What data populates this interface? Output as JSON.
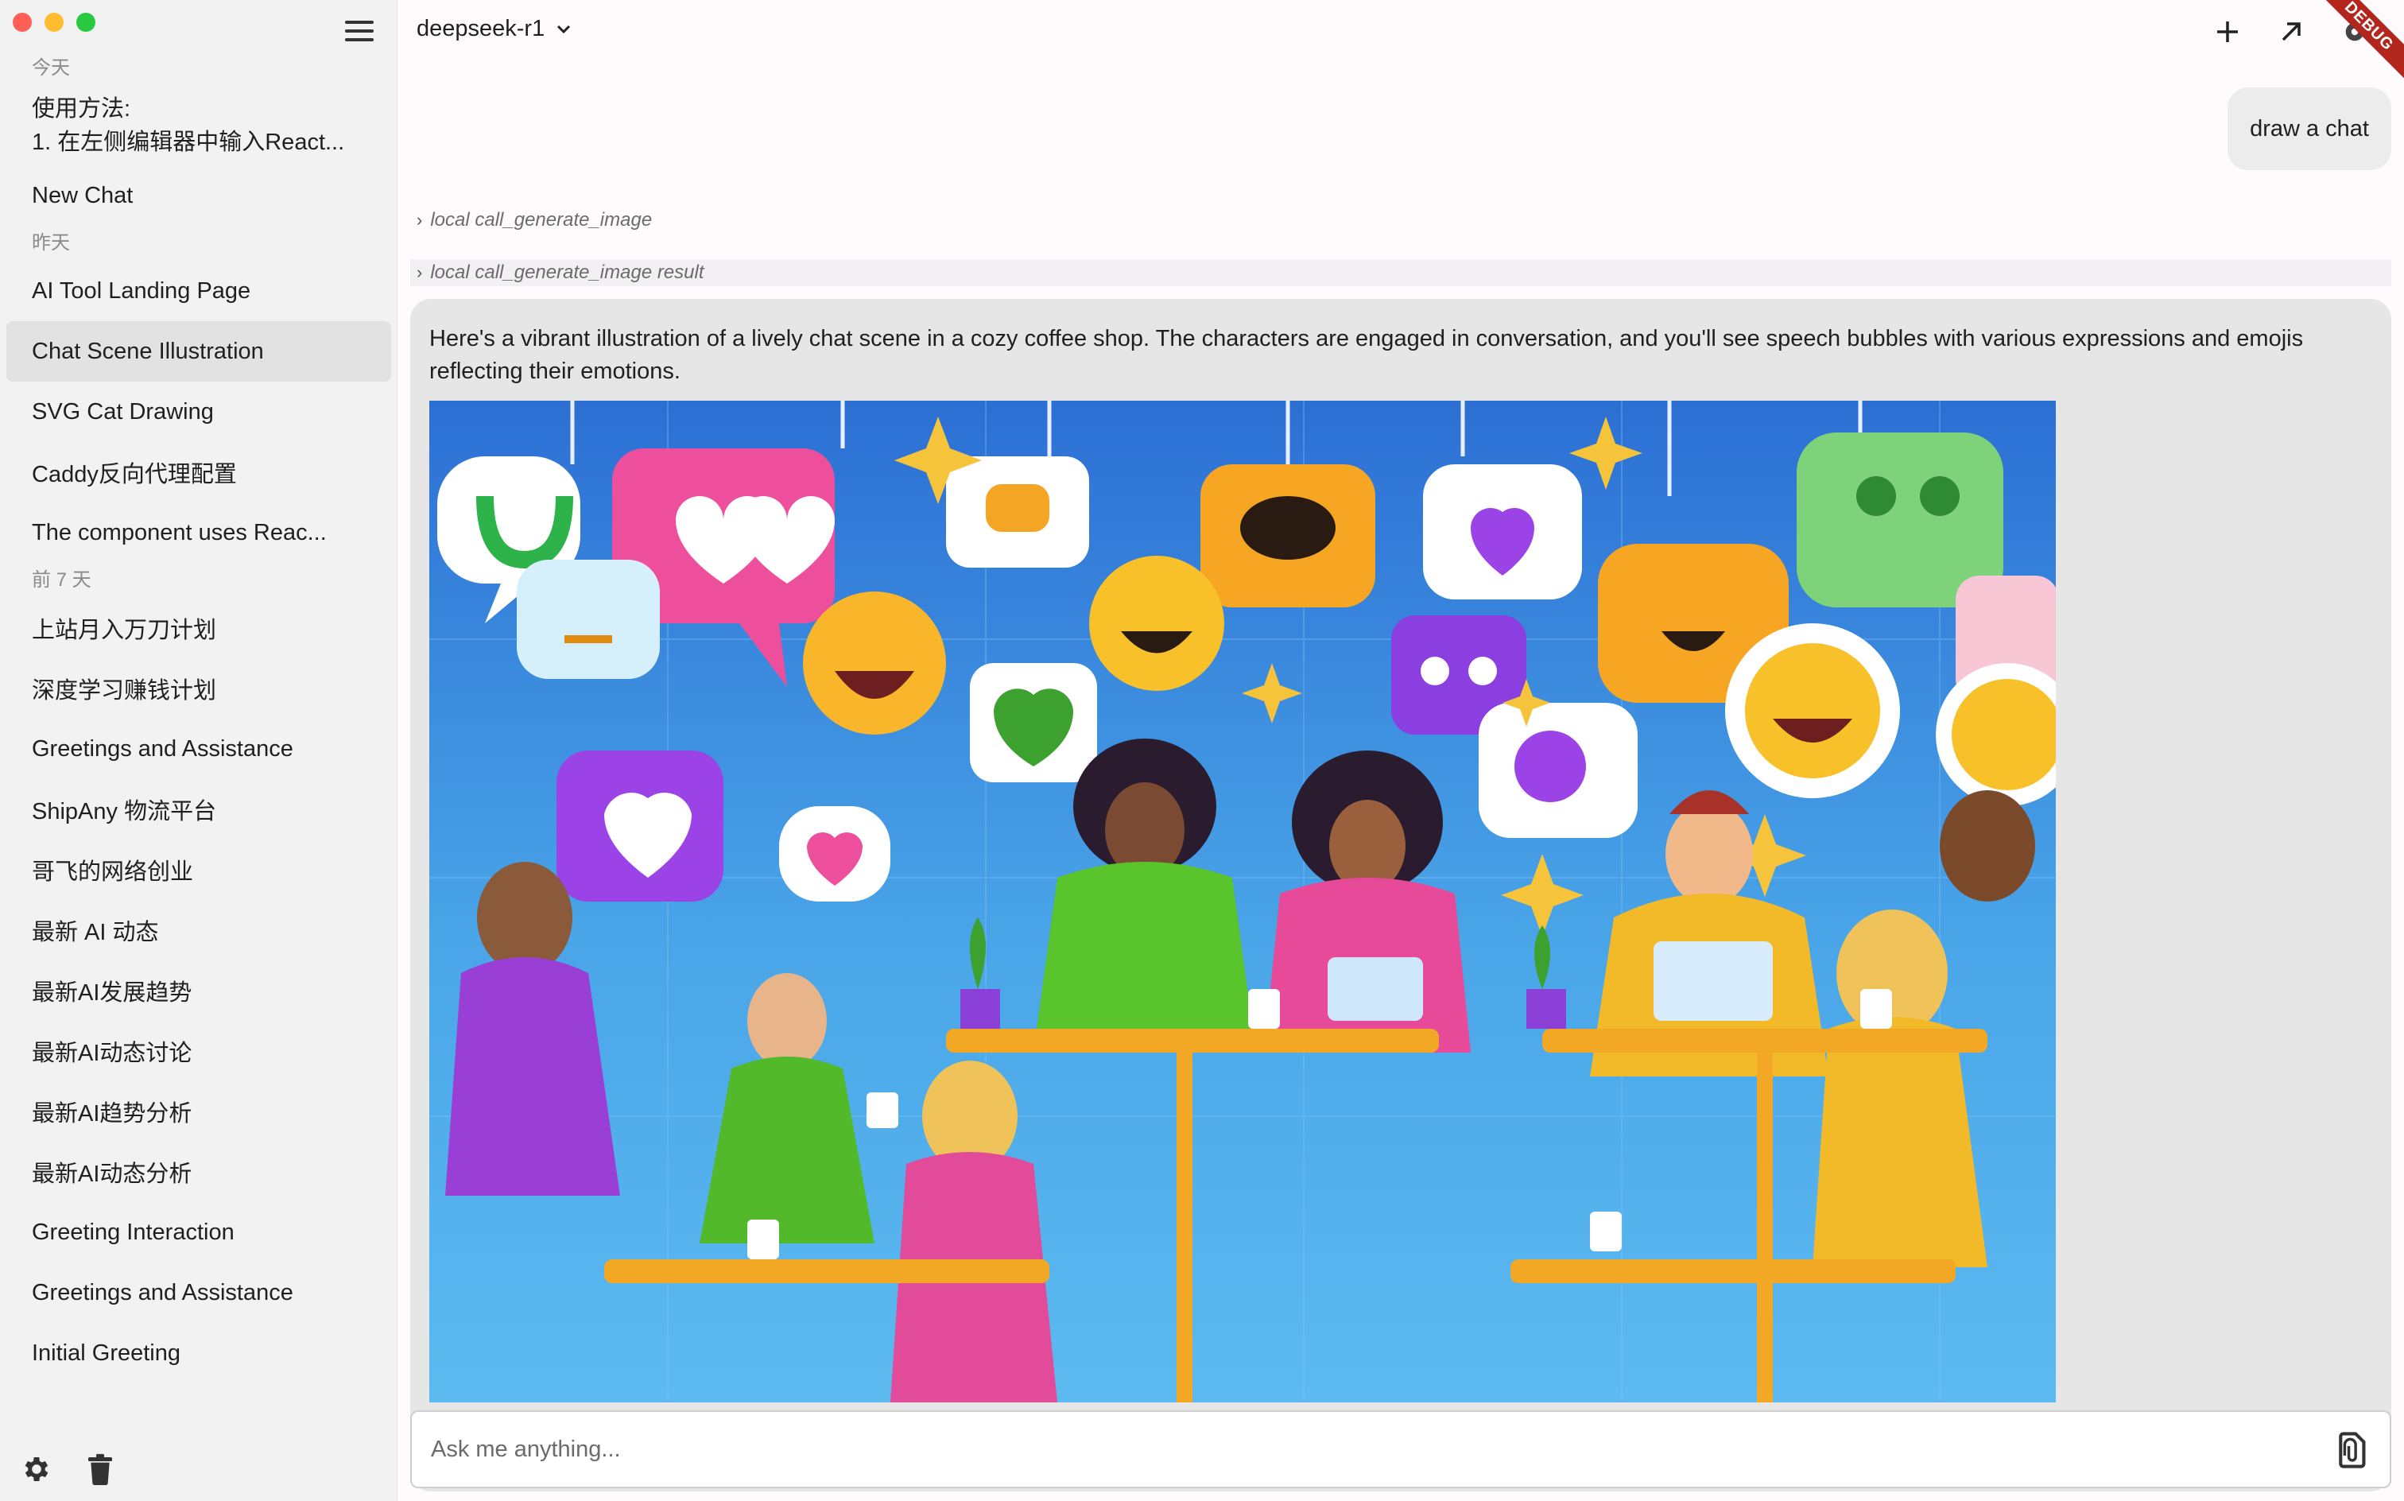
{
  "sidebar": {
    "groups": [
      {
        "label": "今天",
        "items": [
          {
            "label": "使用方法:",
            "label2": "1. 在左侧编辑器中输入React..."
          },
          {
            "label": "New Chat"
          }
        ]
      },
      {
        "label": "昨天",
        "items": [
          {
            "label": "AI Tool Landing Page"
          },
          {
            "label": "Chat Scene Illustration",
            "active": true
          },
          {
            "label": "SVG Cat Drawing"
          },
          {
            "label": "Caddy反向代理配置"
          },
          {
            "label": "The component uses Reac..."
          }
        ]
      },
      {
        "label": "前 7 天",
        "items": [
          {
            "label": "上站月入万刀计划"
          },
          {
            "label": "深度学习赚钱计划"
          },
          {
            "label": "Greetings and Assistance"
          },
          {
            "label": "ShipAny 物流平台"
          },
          {
            "label": "哥飞的网络创业"
          },
          {
            "label": "最新 AI 动态"
          },
          {
            "label": "最新AI发展趋势"
          },
          {
            "label": "最新AI动态讨论"
          },
          {
            "label": "最新AI趋势分析"
          },
          {
            "label": "最新AI动态分析"
          },
          {
            "label": "Greeting Interaction"
          },
          {
            "label": "Greetings and Assistance"
          },
          {
            "label": "Initial Greeting"
          }
        ]
      }
    ],
    "footer_icons": [
      "gear-icon",
      "trash-icon"
    ]
  },
  "header": {
    "model": "deepseek-r1",
    "actions": [
      "plus-icon",
      "arrow-up-right-icon",
      "settings-icon"
    ],
    "debug_banner": "DEBUG"
  },
  "conversation": {
    "user_message": "draw a chat",
    "tool_calls": [
      {
        "label": "local call_generate_image"
      },
      {
        "label": "local call_generate_image result"
      }
    ],
    "assistant_message": "Here's a vibrant illustration of a lively chat scene in a cozy coffee shop. The characters are engaged in conversation, and you'll see speech bubbles with various expressions and emojis reflecting their emotions."
  },
  "input": {
    "placeholder": "Ask me anything..."
  },
  "colors": {
    "sidebar_bg": "#f2f2f2",
    "active_item": "#e2e2e2",
    "bubble_bg": "#ececec",
    "card_bg": "#e6e6e6",
    "debug": "#b3261e"
  }
}
